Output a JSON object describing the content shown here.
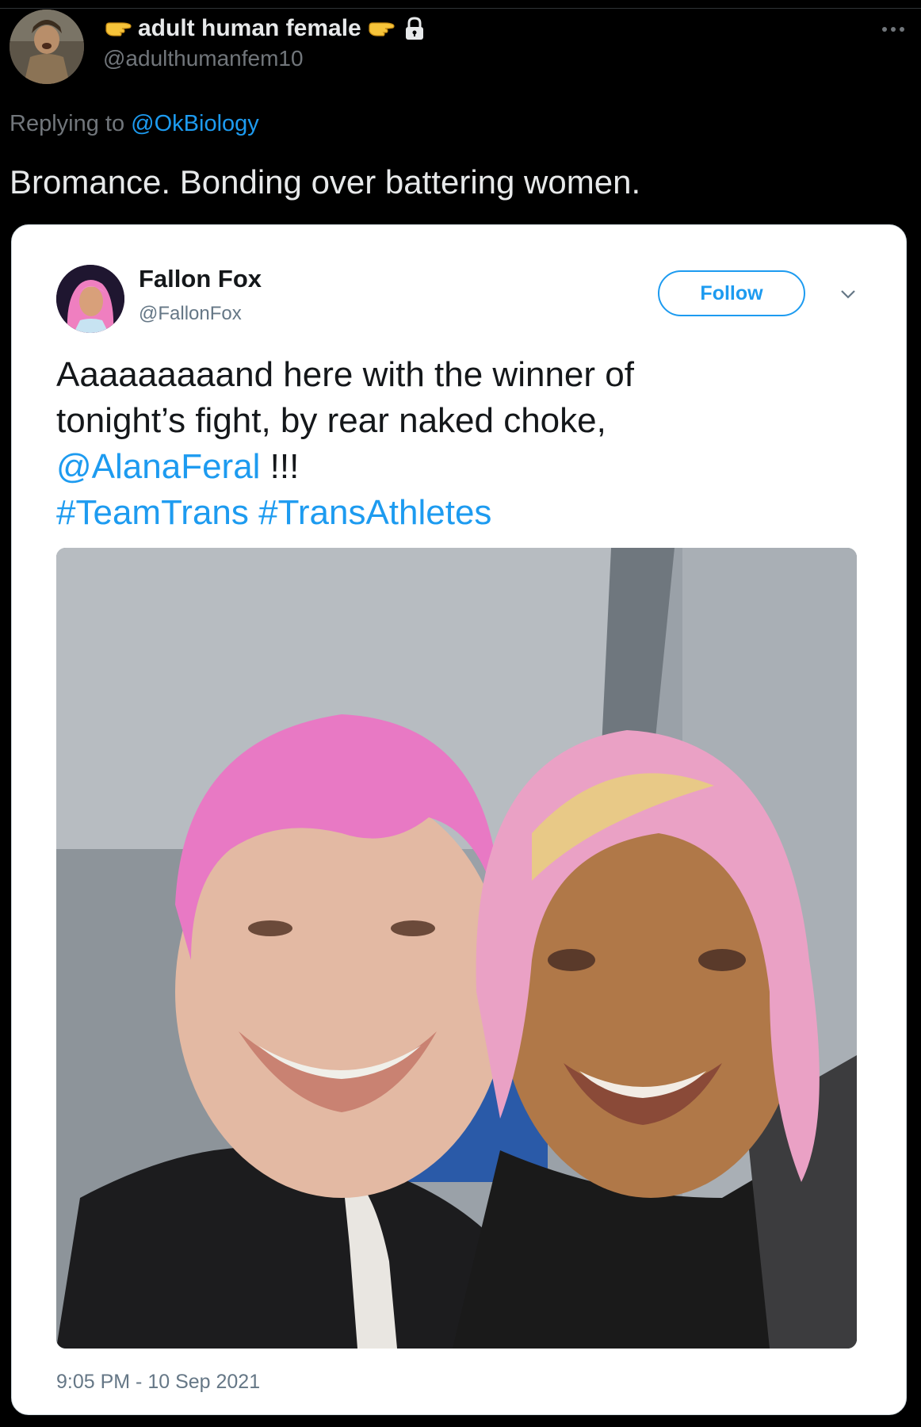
{
  "tweet": {
    "display_name": "adult human female",
    "handle": "@adulthumanfem10",
    "more_icon": "more-horizontal-icon",
    "reply_prefix": "Replying to",
    "reply_mention": "@OkBiology",
    "text": "Bromance. Bonding over battering women."
  },
  "embedded": {
    "display_name": "Fallon Fox",
    "handle": "@FallonFox",
    "follow_label": "Follow",
    "text_line1": "Aaaaaaaaand here with the winner of",
    "text_line2": "tonight’s fight, by rear naked choke,",
    "mention": "@AlanaFeral",
    "mention_suffix": " !!!",
    "hashtag1": "#TeamTrans",
    "hashtag2": "#TransAthletes",
    "timestamp": "9:05 PM - 10 Sep 2021"
  },
  "colors": {
    "background": "#000000",
    "text": "#e7e9ea",
    "muted": "#71767b",
    "link": "#1d9bf0",
    "card_background": "#ffffff"
  }
}
